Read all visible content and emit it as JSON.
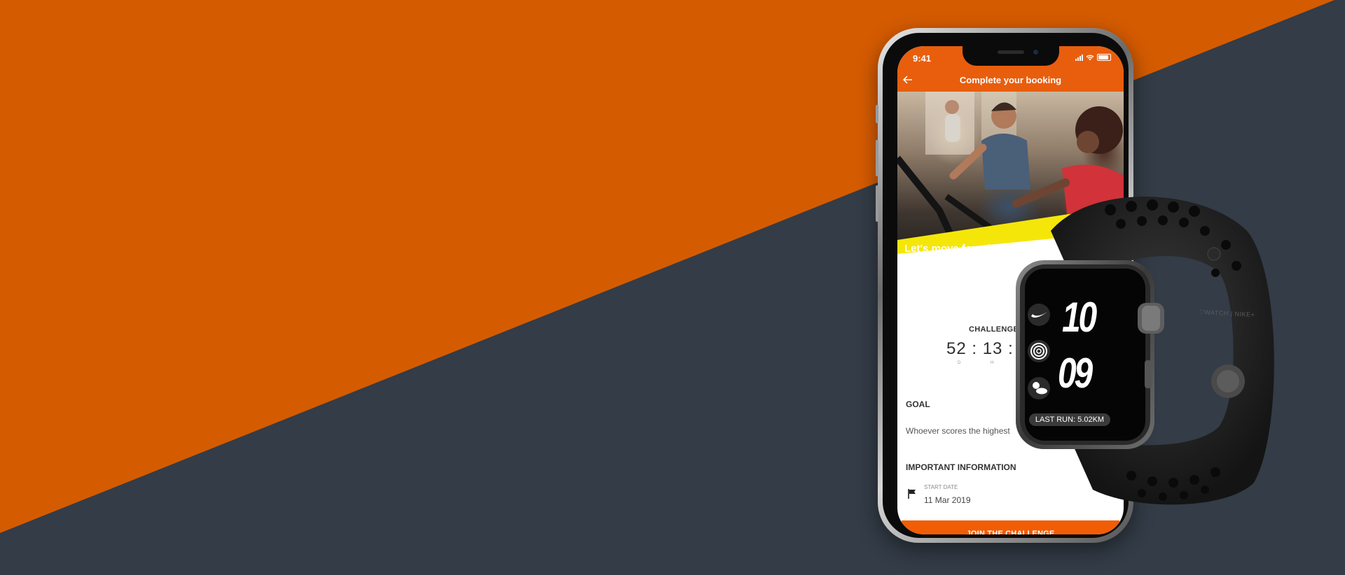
{
  "colors": {
    "orange_bg": "#d55b00",
    "slate_bg": "#333c47",
    "app_orange": "#e85e0d",
    "cta_orange": "#f15d05",
    "highlight_yellow": "#f5e60a"
  },
  "phone": {
    "status_time": "9:41",
    "header_title": "Complete your booking",
    "back_icon": "arrow-left-icon",
    "hero_text": "Let's move for a better world",
    "countdown_label": "CHALLENGE",
    "countdown_value": "52 : 13 : 1",
    "countdown_units": [
      "D",
      "H"
    ],
    "goal_title": "GOAL",
    "goal_text": "Whoever scores the highest",
    "info_title": "IMPORTANT INFORMATION",
    "start_label": "START DATE",
    "start_value": "11 Mar 2019",
    "cta_label": "JOIN THE CHALLENGE"
  },
  "watch": {
    "hour": "10",
    "minute": "09",
    "last_run": "LAST RUN: 5.02KM",
    "strap_text": "WATCH | NIKE+",
    "complications": [
      "nike-swoosh-icon",
      "activity-rings-icon",
      "weather-icon"
    ]
  }
}
